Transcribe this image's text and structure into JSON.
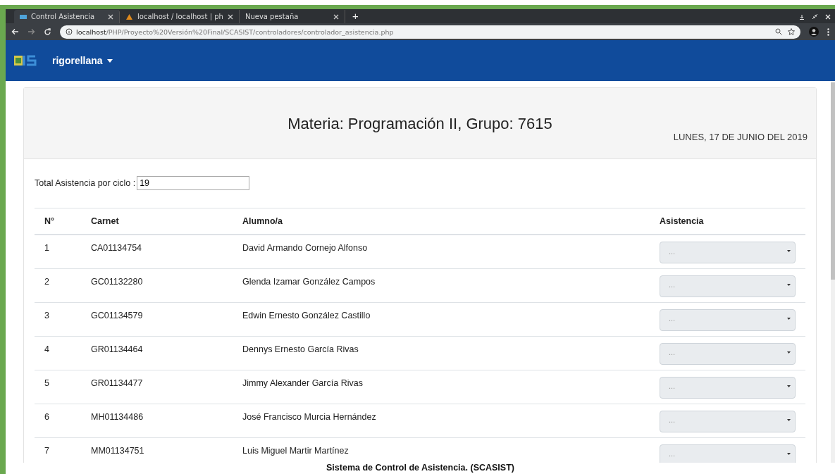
{
  "browser": {
    "tabs": [
      {
        "title": "Control Asistencia",
        "selected": true
      },
      {
        "title": "localhost / localhost | ph",
        "selected": false
      },
      {
        "title": "Nueva pestaña",
        "selected": false
      }
    ],
    "new_tab": "+",
    "url_host": "localhost",
    "url_path": "/PHP/Proyecto%20Versión%20Final/SCASIST/controladores/controlador_asistencia.php"
  },
  "navbar": {
    "user": "rigorellana"
  },
  "header": {
    "title": "Materia: Programación II, Grupo: 7615",
    "date": "LUNES, 17 DE JUNIO DEL 2019"
  },
  "total": {
    "label": "Total Asistencia por ciclo :",
    "value": "19"
  },
  "table": {
    "columns": [
      "N°",
      "Carnet",
      "Alumno/a",
      "Asistencia"
    ],
    "rows": [
      {
        "n": "1",
        "carnet": "CA01134754",
        "alumno": "David Armando Cornejo Alfonso",
        "asistencia": "..."
      },
      {
        "n": "2",
        "carnet": "GC01132280",
        "alumno": "Glenda Izamar González Campos",
        "asistencia": "..."
      },
      {
        "n": "3",
        "carnet": "GC01134579",
        "alumno": "Edwin Ernesto González Castillo",
        "asistencia": "..."
      },
      {
        "n": "4",
        "carnet": "GR01134464",
        "alumno": "Dennys Ernesto García Rivas",
        "asistencia": "..."
      },
      {
        "n": "5",
        "carnet": "GR01134477",
        "alumno": "Jimmy Alexander García Rivas",
        "asistencia": "..."
      },
      {
        "n": "6",
        "carnet": "MH01134486",
        "alumno": "José Francisco Murcia Hernández",
        "asistencia": "..."
      },
      {
        "n": "7",
        "carnet": "MM01134751",
        "alumno": "Luis Miguel Martir Martínez",
        "asistencia": "..."
      }
    ]
  },
  "footer": "Sistema de Control de Asistencia. (SCASIST)"
}
